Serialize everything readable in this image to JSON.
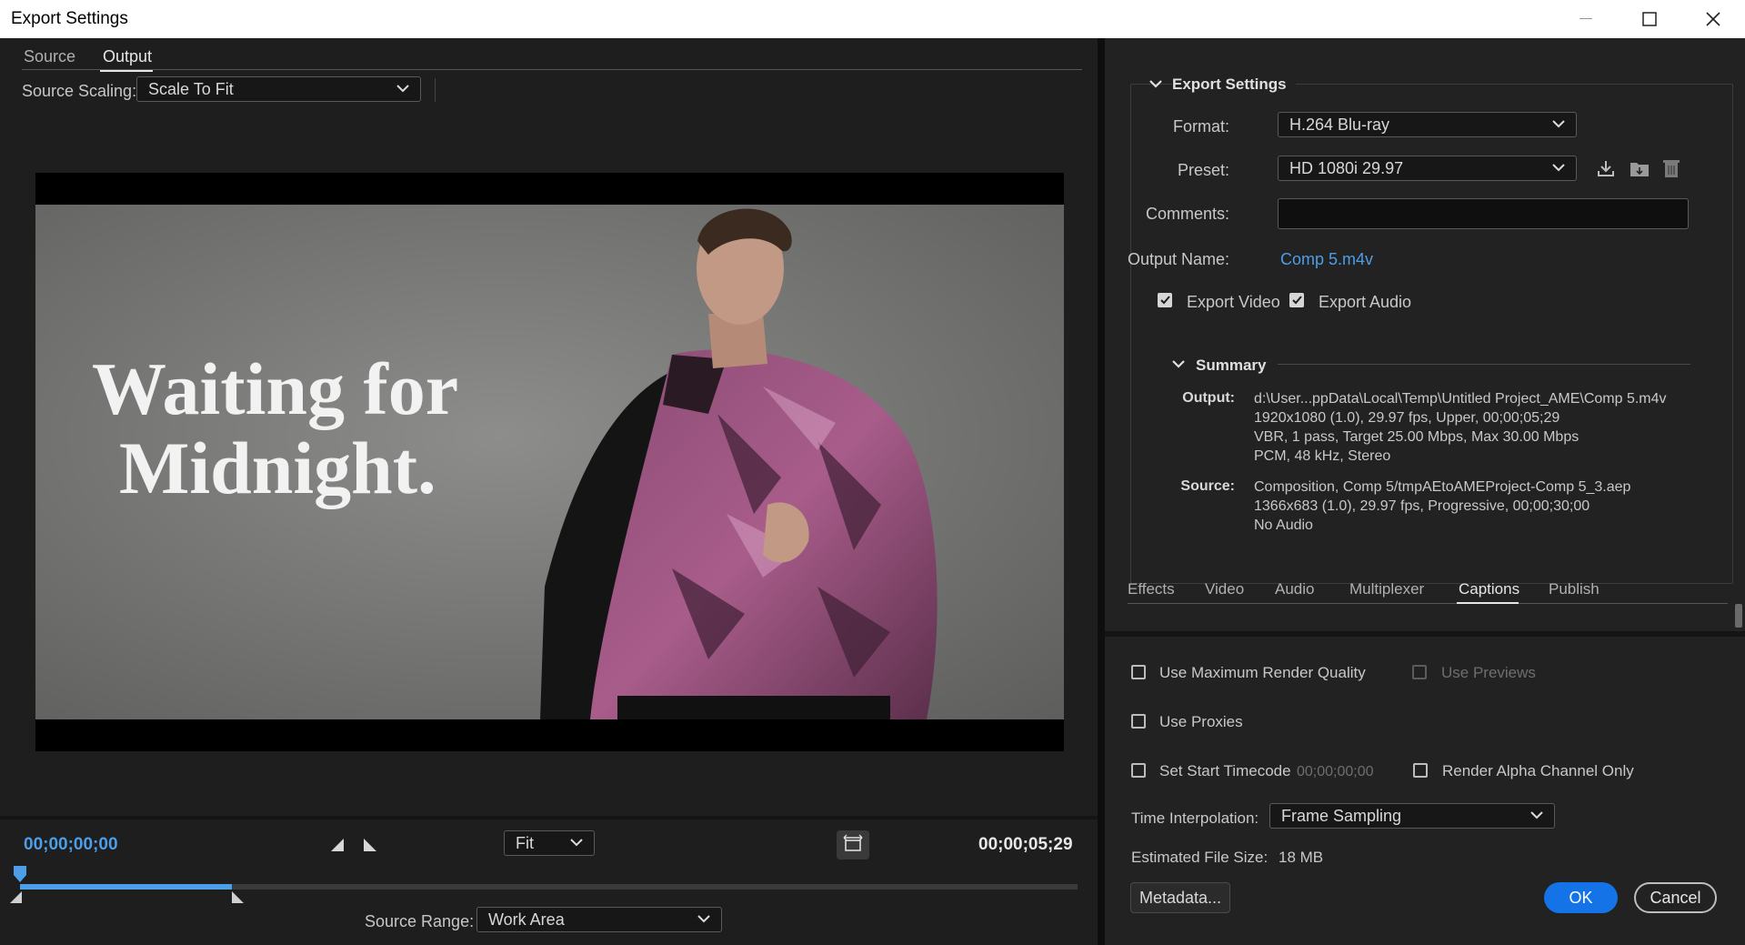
{
  "window": {
    "title": "Export Settings",
    "controls": [
      "minimize-icon",
      "maximize-icon",
      "close-icon"
    ]
  },
  "left": {
    "tabs": [
      {
        "label": "Source",
        "active": false
      },
      {
        "label": "Output",
        "active": true
      }
    ],
    "source_scaling": {
      "label": "Source Scaling:",
      "value": "Scale To Fit"
    },
    "preview": {
      "headline_line1": "Waiting for",
      "headline_line2": "Midnight."
    },
    "timeline": {
      "current_time": "00;00;00;00",
      "end_time": "00;00;05;29",
      "zoom": "Fit",
      "progress": 0.2,
      "source_range_label": "Source Range:",
      "source_range_value": "Work Area"
    }
  },
  "right": {
    "export_settings": {
      "header": "Export Settings",
      "format_label": "Format:",
      "format_value": "H.264 Blu-ray",
      "preset_label": "Preset:",
      "preset_value": "HD 1080i 29.97",
      "comments_label": "Comments:",
      "comments_value": "",
      "output_name_label": "Output Name:",
      "output_name_value": "Comp 5.m4v",
      "export_video_label": "Export Video",
      "export_video_checked": true,
      "export_audio_label": "Export Audio",
      "export_audio_checked": true
    },
    "summary": {
      "header": "Summary",
      "output_label": "Output:",
      "output_lines": [
        "d:\\User...ppData\\Local\\Temp\\Untitled Project_AME\\Comp 5.m4v",
        "1920x1080 (1.0), 29.97 fps, Upper, 00;00;05;29",
        "VBR, 1 pass, Target 25.00 Mbps, Max 30.00 Mbps",
        "PCM, 48 kHz, Stereo"
      ],
      "source_label": "Source:",
      "source_lines": [
        "Composition, Comp 5/tmpAEtoAMEProject-Comp 5_3.aep",
        "1366x683 (1.0), 29.97 fps, Progressive, 00;00;30;00",
        "No Audio"
      ]
    },
    "tabs": [
      {
        "label": "Effects",
        "active": false
      },
      {
        "label": "Video",
        "active": false
      },
      {
        "label": "Audio",
        "active": false
      },
      {
        "label": "Multiplexer",
        "active": false
      },
      {
        "label": "Captions",
        "active": true
      },
      {
        "label": "Publish",
        "active": false
      }
    ],
    "options": {
      "max_render_quality": "Use Maximum Render Quality",
      "use_previews": "Use Previews",
      "use_proxies": "Use Proxies",
      "set_start_timecode": "Set Start Timecode",
      "start_timecode_value": "00;00;00;00",
      "render_alpha": "Render Alpha Channel Only",
      "time_interpolation_label": "Time Interpolation:",
      "time_interpolation_value": "Frame Sampling",
      "est_file_size_label": "Estimated File Size:",
      "est_file_size_value": "18 MB"
    },
    "buttons": {
      "metadata": "Metadata...",
      "ok": "OK",
      "cancel": "Cancel"
    }
  },
  "colors": {
    "accent": "#1473e6",
    "link": "#4d9ee9",
    "timecode": "#4d9ee9",
    "panel": "#222222"
  }
}
